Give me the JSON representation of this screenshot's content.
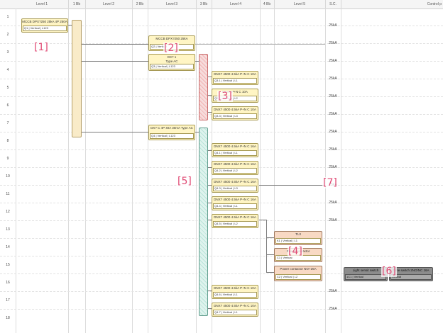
{
  "header": {
    "columns": [
      "Level 1",
      "1 Bb",
      "Level 2",
      "2 Bb",
      "Level 3",
      "3 Bb",
      "Level 4",
      "4 Bb",
      "Level 5",
      "S.C.",
      "Control p"
    ]
  },
  "rows": [
    "1",
    "2",
    "3",
    "4",
    "5",
    "6",
    "7",
    "8",
    "9",
    "10",
    "11",
    "12",
    "13",
    "14",
    "15",
    "16",
    "17",
    "18"
  ],
  "devices": {
    "d1": {
      "title": "MCCB DPX?250 25kA 4P 250A",
      "foot": "Q1 | Vertical | L123"
    },
    "d2": {
      "title": "MCCB DPX?250 25kA",
      "foot": "Q2 | Vertical"
    },
    "d3": {
      "title": "DX? 1",
      "subtitle": "Type AC",
      "foot": "Q3 | Vertical | L123"
    },
    "d4": {
      "title": "DX? C 4P 40A 30mA Type AC",
      "foot": "Q4 | Vertical | L123"
    },
    "r4": {
      "title": "DNX? 4500 4.5kA P+N C 10A",
      "foot": "Q3.1 | Vertical | L1"
    },
    "r5": {
      "title": "DNX? P+N C 10A",
      "foot": "Q3.2 | Vertical | L2"
    },
    "r6": {
      "title": "DNX? 4500 4.5kA P+N C 10A",
      "foot": "Q3.3 | Vertical | L3"
    },
    "r8": {
      "title": "DNX? 4500 4.5kA P+N C 16A",
      "foot": "Q4.1 | Vertical | L1"
    },
    "r9": {
      "title": "DNX? 4500 4.5kA P+N C 16A",
      "foot": "Q4.2 | Vertical | L2"
    },
    "r10": {
      "title": "DNX? 4500 4.5kA P+N C 16A",
      "foot": "Q4.3 | Vertical | L3"
    },
    "r11": {
      "title": "DNX? 4500 4.5kA P+N C 16A",
      "foot": "Q4.4 | Vertical | L1"
    },
    "r12": {
      "title": "DNX? 4500 4.5kA P+N C 16A",
      "foot": "Q4.5 | Vertical | L2"
    },
    "r16": {
      "title": "DNX? 4500 4.5kA P+N C 10A",
      "foot": "Q4.6 | Vertical | L1"
    },
    "r17": {
      "title": "DNX? 4500 4.5kA P+N C 10A",
      "foot": "Q4.7 | Vertical | L1"
    },
    "tl": {
      "title": "TL3",
      "foot": "K1 | Vertical | L1"
    },
    "pc1": {
      "title": "Power contactor",
      "foot": "C1 | Vertical"
    },
    "pc2": {
      "title": "Power contactor NO+25A",
      "foot": "C2 | Vertical | L2"
    },
    "light": {
      "title": "Light sensit switch",
      "foot": "1C1 | Vertical"
    },
    "timer": {
      "title": "Time switch 2NO/NC 16A",
      "foot": "Vertical"
    }
  },
  "short_circuit": [
    {
      "row": "1",
      "value": "25kA"
    },
    {
      "row": "2",
      "value": "25kA"
    },
    {
      "row": "3",
      "value": "25kA"
    },
    {
      "row": "4",
      "value": "25kA"
    },
    {
      "row": "5",
      "value": "25kA"
    },
    {
      "row": "6",
      "value": "25kA"
    },
    {
      "row": "7",
      "value": "25kA"
    },
    {
      "row": "8",
      "value": "25kA"
    },
    {
      "row": "9",
      "value": "25kA"
    },
    {
      "row": "10",
      "value": "25kA"
    },
    {
      "row": "11",
      "value": "25kA"
    },
    {
      "row": "12",
      "value": "25kA"
    },
    {
      "row": "16",
      "value": "25kA"
    },
    {
      "row": "17",
      "value": "25kA"
    }
  ],
  "callouts": [
    "[1]",
    "[2]",
    "[3]",
    "[4]",
    "[5]",
    "[6]",
    "[7]"
  ]
}
